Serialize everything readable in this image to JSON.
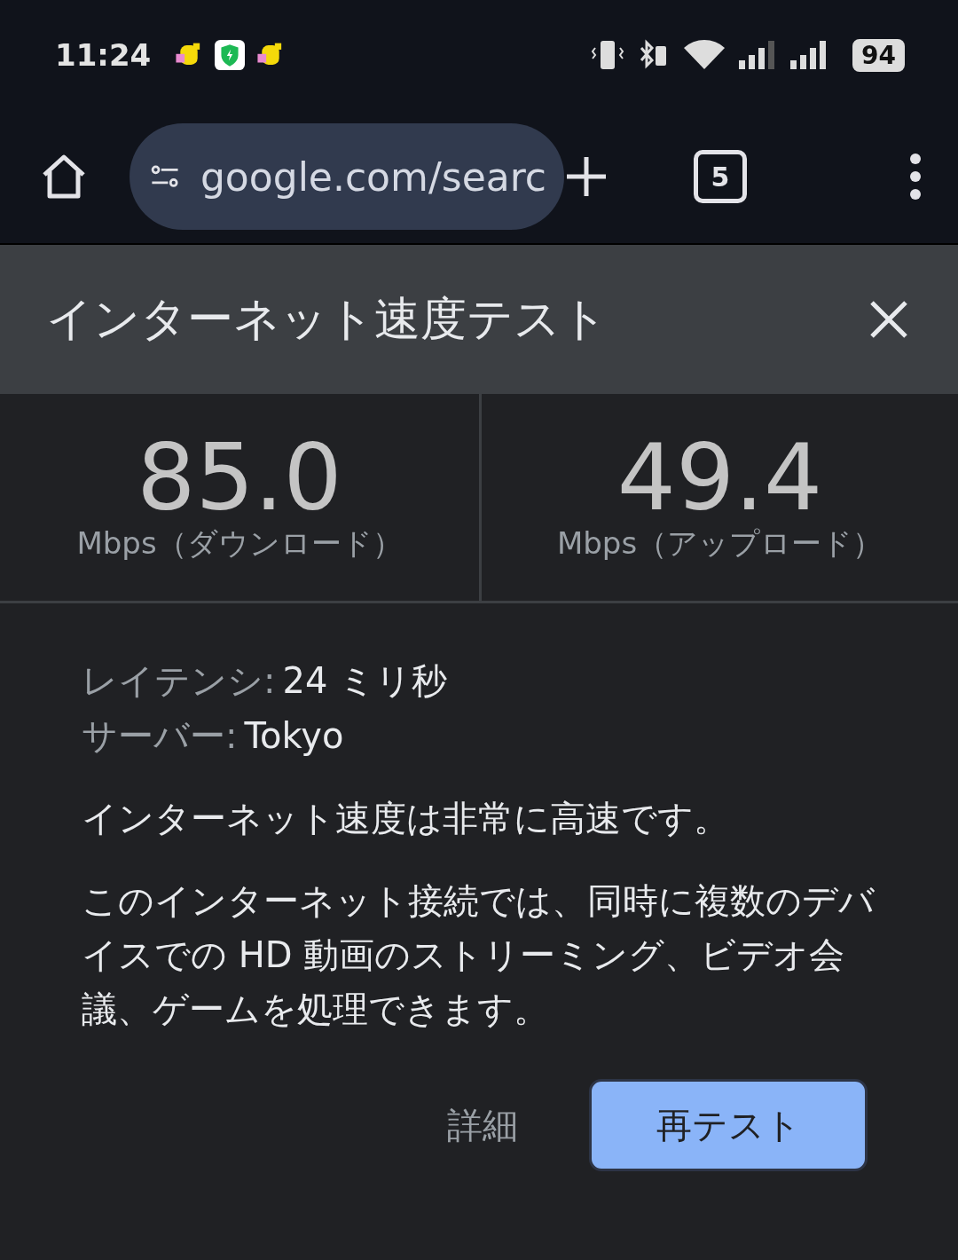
{
  "status_bar": {
    "time": "11:24",
    "battery": "94"
  },
  "browser_toolbar": {
    "url": "google.com/searc",
    "tab_count": "5"
  },
  "panel": {
    "title": "インターネット速度テスト",
    "results": [
      {
        "value": "85.0",
        "unit": "Mbps（ダウンロード）"
      },
      {
        "value": "49.4",
        "unit": "Mbps（アップロード）"
      }
    ],
    "details": [
      {
        "label": "レイテンシ:",
        "value": "24 ミリ秒"
      },
      {
        "label": "サーバー:",
        "value": "Tokyo"
      }
    ],
    "summary": "インターネット速度は非常に高速です。",
    "description": "このインターネット接続では、同時に複数のデバイスでの HD 動画のストリーミング、ビデオ会議、ゲームを処理できます。",
    "buttons": [
      {
        "label": "詳細",
        "kind": "text"
      },
      {
        "label": "再テスト",
        "kind": "filled"
      }
    ]
  }
}
